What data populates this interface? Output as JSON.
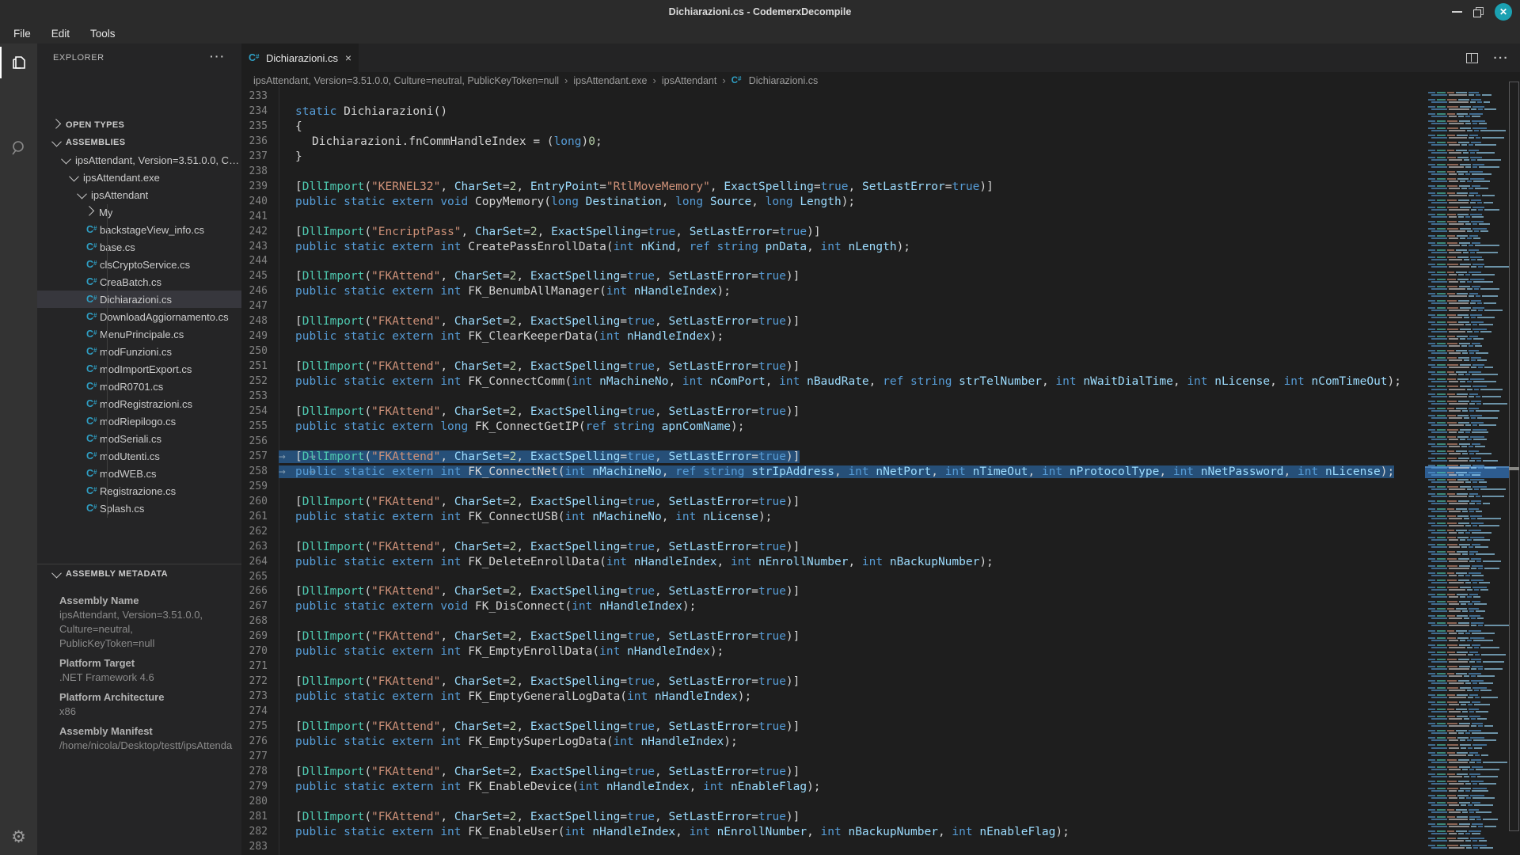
{
  "window": {
    "title": "Dichiarazioni.cs - CodemerxDecompile",
    "controls": {
      "minimize": "minimize",
      "maximize": "maximize",
      "close": "✕"
    }
  },
  "menu": {
    "items": [
      "File",
      "Edit",
      "Tools"
    ]
  },
  "activity_bar": {
    "items": [
      {
        "icon": "files-icon",
        "active": true
      },
      {
        "icon": "search-icon",
        "active": false
      },
      {
        "icon": "gear-icon",
        "active": false,
        "glyph": "⚙"
      }
    ]
  },
  "sidebar": {
    "header": "EXPLORER",
    "more_label": "···",
    "tree": [
      {
        "label": "OPEN TYPES",
        "kind": "header",
        "chev": "closed",
        "indent": 0
      },
      {
        "label": "ASSEMBLIES",
        "kind": "header",
        "chev": "open",
        "indent": 0
      },
      {
        "label": "ipsAttendant, Version=3.51.0.0, Cul…",
        "kind": "node",
        "chev": "open",
        "indent": 1
      },
      {
        "label": "ipsAttendant.exe",
        "kind": "node",
        "chev": "open",
        "indent": 2
      },
      {
        "label": "ipsAttendant",
        "kind": "node",
        "chev": "open",
        "indent": 3
      },
      {
        "label": "My",
        "kind": "node",
        "chev": "closed",
        "indent": 4
      },
      {
        "label": "backstageView_info.cs",
        "kind": "file",
        "indent": 4
      },
      {
        "label": "base.cs",
        "kind": "file",
        "indent": 4
      },
      {
        "label": "clsCryptoService.cs",
        "kind": "file",
        "indent": 4
      },
      {
        "label": "CreaBatch.cs",
        "kind": "file",
        "indent": 4
      },
      {
        "label": "Dichiarazioni.cs",
        "kind": "file",
        "indent": 4,
        "selected": true
      },
      {
        "label": "DownloadAggiornamento.cs",
        "kind": "file",
        "indent": 4
      },
      {
        "label": "MenuPrincipale.cs",
        "kind": "file",
        "indent": 4
      },
      {
        "label": "modFunzioni.cs",
        "kind": "file",
        "indent": 4
      },
      {
        "label": "modImportExport.cs",
        "kind": "file",
        "indent": 4
      },
      {
        "label": "modR0701.cs",
        "kind": "file",
        "indent": 4
      },
      {
        "label": "modRegistrazioni.cs",
        "kind": "file",
        "indent": 4
      },
      {
        "label": "modRiepilogo.cs",
        "kind": "file",
        "indent": 4
      },
      {
        "label": "modSeriali.cs",
        "kind": "file",
        "indent": 4
      },
      {
        "label": "modUtenti.cs",
        "kind": "file",
        "indent": 4
      },
      {
        "label": "modWEB.cs",
        "kind": "file",
        "indent": 4
      },
      {
        "label": "Registrazione.cs",
        "kind": "file",
        "indent": 4
      },
      {
        "label": "Splash.cs",
        "kind": "file",
        "indent": 4
      }
    ],
    "metadata_header": "ASSEMBLY METADATA",
    "metadata": [
      {
        "label": "Assembly Name",
        "values": [
          "ipsAttendant, Version=3.51.0.0,",
          "Culture=neutral,",
          "PublicKeyToken=null"
        ]
      },
      {
        "label": "Platform Target",
        "values": [
          ".NET Framework 4.6"
        ]
      },
      {
        "label": "Platform Architecture",
        "values": [
          "x86"
        ]
      },
      {
        "label": "Assembly Manifest",
        "values": [
          "/home/nicola/Desktop/testt/ipsAttenda"
        ]
      }
    ]
  },
  "editor": {
    "tab": {
      "label": "Dichiarazioni.cs",
      "close": "×"
    },
    "breadcrumb": [
      "ipsAttendant, Version=3.51.0.0, Culture=neutral, PublicKeyToken=null",
      "ipsAttendant.exe",
      "ipsAttendant",
      "Dichiarazioni.cs"
    ],
    "breadcrumb_sep": "›",
    "code": {
      "first_line": 233,
      "selected_lines": [
        257,
        258
      ],
      "lines": [
        {
          "n": 233,
          "b": true
        },
        {
          "n": 234,
          "i": 1,
          "tk": [
            [
              "k",
              "static"
            ],
            [
              "p",
              " Dichiarazioni()"
            ]
          ]
        },
        {
          "n": 235,
          "i": 1,
          "tk": [
            [
              "p",
              "{"
            ]
          ]
        },
        {
          "n": 236,
          "i": 2,
          "tk": [
            [
              "p",
              "Dichiarazioni.fnCommHandleIndex = ("
            ],
            [
              "k",
              "long"
            ],
            [
              "p",
              ")"
            ],
            [
              "n2",
              "0"
            ],
            [
              "p",
              ";"
            ]
          ]
        },
        {
          "n": 237,
          "i": 1,
          "tk": [
            [
              "p",
              "}"
            ]
          ]
        },
        {
          "n": 238,
          "b": true
        },
        {
          "n": 239,
          "i": 1,
          "attr": {
            "lib": "KERNEL32",
            "entry": "RtlMoveMemory"
          }
        },
        {
          "n": 240,
          "i": 1,
          "decl": {
            "ret": "void",
            "name": "CopyMemory",
            "params": [
              [
                "long",
                "Destination"
              ],
              [
                "long",
                "Source"
              ],
              [
                "long",
                "Length"
              ]
            ]
          }
        },
        {
          "n": 241,
          "b": true
        },
        {
          "n": 242,
          "i": 1,
          "attr": {
            "lib": "EncriptPass"
          }
        },
        {
          "n": 243,
          "i": 1,
          "decl": {
            "ret": "int",
            "name": "CreatePassEnrollData",
            "params": [
              [
                "int",
                "nKind"
              ],
              [
                "ref string",
                "pnData"
              ],
              [
                "int",
                "nLength"
              ]
            ]
          }
        },
        {
          "n": 244,
          "b": true
        },
        {
          "n": 245,
          "i": 1,
          "attr": {
            "lib": "FKAttend"
          }
        },
        {
          "n": 246,
          "i": 1,
          "decl": {
            "ret": "int",
            "name": "FK_BenumbAllManager",
            "params": [
              [
                "int",
                "nHandleIndex"
              ]
            ]
          }
        },
        {
          "n": 247,
          "b": true
        },
        {
          "n": 248,
          "i": 1,
          "attr": {
            "lib": "FKAttend"
          }
        },
        {
          "n": 249,
          "i": 1,
          "decl": {
            "ret": "int",
            "name": "FK_ClearKeeperData",
            "params": [
              [
                "int",
                "nHandleIndex"
              ]
            ]
          }
        },
        {
          "n": 250,
          "b": true
        },
        {
          "n": 251,
          "i": 1,
          "attr": {
            "lib": "FKAttend"
          }
        },
        {
          "n": 252,
          "i": 1,
          "decl": {
            "ret": "int",
            "name": "FK_ConnectComm",
            "params": [
              [
                "int",
                "nMachineNo"
              ],
              [
                "int",
                "nComPort"
              ],
              [
                "int",
                "nBaudRate"
              ],
              [
                "ref string",
                "strTelNumber"
              ],
              [
                "int",
                "nWaitDialTime"
              ],
              [
                "int",
                "nLicense"
              ],
              [
                "int",
                "nComTimeOut"
              ]
            ]
          }
        },
        {
          "n": 253,
          "b": true
        },
        {
          "n": 254,
          "i": 1,
          "attr": {
            "lib": "FKAttend"
          }
        },
        {
          "n": 255,
          "i": 1,
          "decl": {
            "ret": "long",
            "name": "FK_ConnectGetIP",
            "params": [
              [
                "ref string",
                "apnComName"
              ]
            ]
          }
        },
        {
          "n": 256,
          "b": true
        },
        {
          "n": 257,
          "i": 1,
          "sel": true,
          "attr": {
            "lib": "FKAttend"
          }
        },
        {
          "n": 258,
          "i": 1,
          "sel": true,
          "decl": {
            "ret": "int",
            "name": "FK_ConnectNet",
            "params": [
              [
                "int",
                "nMachineNo"
              ],
              [
                "ref string",
                "strIpAddress"
              ],
              [
                "int",
                "nNetPort"
              ],
              [
                "int",
                "nTimeOut"
              ],
              [
                "int",
                "nProtocolType"
              ],
              [
                "int",
                "nNetPassword"
              ],
              [
                "int",
                "nLicense"
              ]
            ]
          }
        },
        {
          "n": 259,
          "b": true
        },
        {
          "n": 260,
          "i": 1,
          "attr": {
            "lib": "FKAttend"
          }
        },
        {
          "n": 261,
          "i": 1,
          "decl": {
            "ret": "int",
            "name": "FK_ConnectUSB",
            "params": [
              [
                "int",
                "nMachineNo"
              ],
              [
                "int",
                "nLicense"
              ]
            ]
          }
        },
        {
          "n": 262,
          "b": true
        },
        {
          "n": 263,
          "i": 1,
          "attr": {
            "lib": "FKAttend"
          }
        },
        {
          "n": 264,
          "i": 1,
          "decl": {
            "ret": "int",
            "name": "FK_DeleteEnrollData",
            "params": [
              [
                "int",
                "nHandleIndex"
              ],
              [
                "int",
                "nEnrollNumber"
              ],
              [
                "int",
                "nBackupNumber"
              ]
            ]
          }
        },
        {
          "n": 265,
          "b": true
        },
        {
          "n": 266,
          "i": 1,
          "attr": {
            "lib": "FKAttend"
          }
        },
        {
          "n": 267,
          "i": 1,
          "decl": {
            "ret": "void",
            "name": "FK_DisConnect",
            "params": [
              [
                "int",
                "nHandleIndex"
              ]
            ]
          }
        },
        {
          "n": 268,
          "b": true
        },
        {
          "n": 269,
          "i": 1,
          "attr": {
            "lib": "FKAttend"
          }
        },
        {
          "n": 270,
          "i": 1,
          "decl": {
            "ret": "int",
            "name": "FK_EmptyEnrollData",
            "params": [
              [
                "int",
                "nHandleIndex"
              ]
            ]
          }
        },
        {
          "n": 271,
          "b": true
        },
        {
          "n": 272,
          "i": 1,
          "attr": {
            "lib": "FKAttend"
          }
        },
        {
          "n": 273,
          "i": 1,
          "decl": {
            "ret": "int",
            "name": "FK_EmptyGeneralLogData",
            "params": [
              [
                "int",
                "nHandleIndex"
              ]
            ]
          }
        },
        {
          "n": 274,
          "b": true
        },
        {
          "n": 275,
          "i": 1,
          "attr": {
            "lib": "FKAttend"
          }
        },
        {
          "n": 276,
          "i": 1,
          "decl": {
            "ret": "int",
            "name": "FK_EmptySuperLogData",
            "params": [
              [
                "int",
                "nHandleIndex"
              ]
            ]
          }
        },
        {
          "n": 277,
          "b": true
        },
        {
          "n": 278,
          "i": 1,
          "attr": {
            "lib": "FKAttend"
          }
        },
        {
          "n": 279,
          "i": 1,
          "decl": {
            "ret": "int",
            "name": "FK_EnableDevice",
            "params": [
              [
                "int",
                "nHandleIndex"
              ],
              [
                "int",
                "nEnableFlag"
              ]
            ]
          }
        },
        {
          "n": 280,
          "b": true
        },
        {
          "n": 281,
          "i": 1,
          "attr": {
            "lib": "FKAttend"
          }
        },
        {
          "n": 282,
          "i": 1,
          "decl": {
            "ret": "int",
            "name": "FK_EnableUser",
            "params": [
              [
                "int",
                "nHandleIndex"
              ],
              [
                "int",
                "nEnrollNumber"
              ],
              [
                "int",
                "nBackupNumber"
              ],
              [
                "int",
                "nEnableFlag"
              ]
            ]
          }
        },
        {
          "n": 283,
          "b": true
        }
      ]
    }
  },
  "colors": {
    "keyword": "#569cd6",
    "type": "#4ec9b0",
    "string": "#ce9178",
    "number": "#b5cea8",
    "param": "#9cdcfe",
    "plain": "#d4d4d4",
    "selection": "#264f78",
    "editor_bg": "#1e1e1e",
    "sidebar_bg": "#252526",
    "titlebar_bg": "#2b2b2b",
    "activitybar_bg": "#333333",
    "accent_close": "#1ba1b2",
    "line_number": "#858585"
  }
}
